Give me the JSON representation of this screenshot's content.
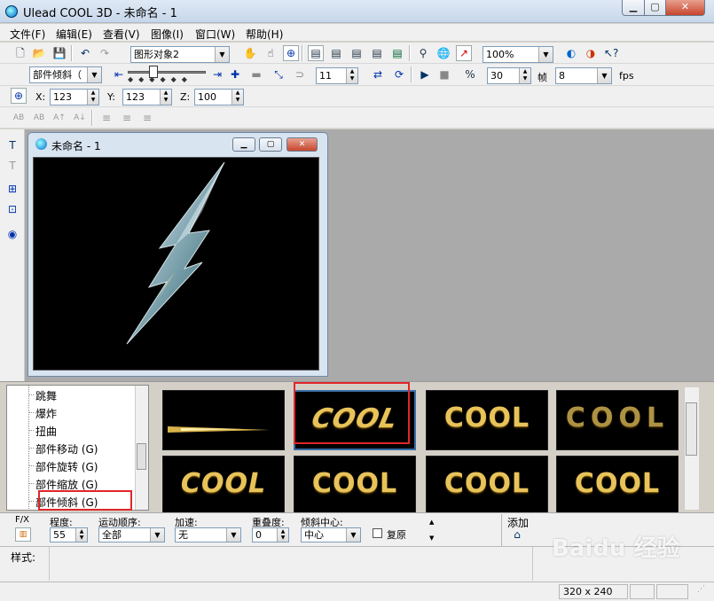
{
  "app": {
    "title": "Ulead COOL 3D - 未命名 - 1"
  },
  "menu": [
    "文件(F)",
    "编辑(E)",
    "查看(V)",
    "图像(I)",
    "窗口(W)",
    "帮助(H)"
  ],
  "toolbar1": {
    "object_combo": "图形对象2",
    "zoom_combo": "100%"
  },
  "toolbar2": {
    "effect_combo": "部件倾斜（",
    "frame_num": "11",
    "fps_value": "30",
    "frame_label": "帧",
    "frames_combo": "8",
    "fps_label": "fps"
  },
  "toolbar3": {
    "x_label": "X:",
    "x_value": "123",
    "y_label": "Y:",
    "y_value": "123",
    "z_label": "Z:",
    "z_value": "100"
  },
  "document": {
    "title": "未命名 - 1"
  },
  "tree": {
    "items": [
      "跳舞",
      "爆炸",
      "扭曲",
      "部件移动 (G)",
      "部件旋转 (G)",
      "部件缩放 (G)",
      "部件倾斜 (G)"
    ]
  },
  "gallery": {
    "thumbs": [
      "",
      "COOL",
      "COOL",
      "COOL",
      "COOL",
      "COOL",
      "COOL",
      "COOL"
    ]
  },
  "options": {
    "fx_label": "F/X",
    "degree_label": "程度:",
    "degree_value": "55",
    "motion_label": "运动顺序:",
    "motion_value": "全部",
    "accel_label": "加速:",
    "accel_value": "无",
    "overlap_label": "重叠度:",
    "overlap_value": "0",
    "center_label": "倾斜中心:",
    "center_value": "中心",
    "restore_label": "复原",
    "add_label": "添加"
  },
  "style": {
    "label": "样式:"
  },
  "status": {
    "size": "320 x 240"
  },
  "watermark": "Baidu 经验"
}
